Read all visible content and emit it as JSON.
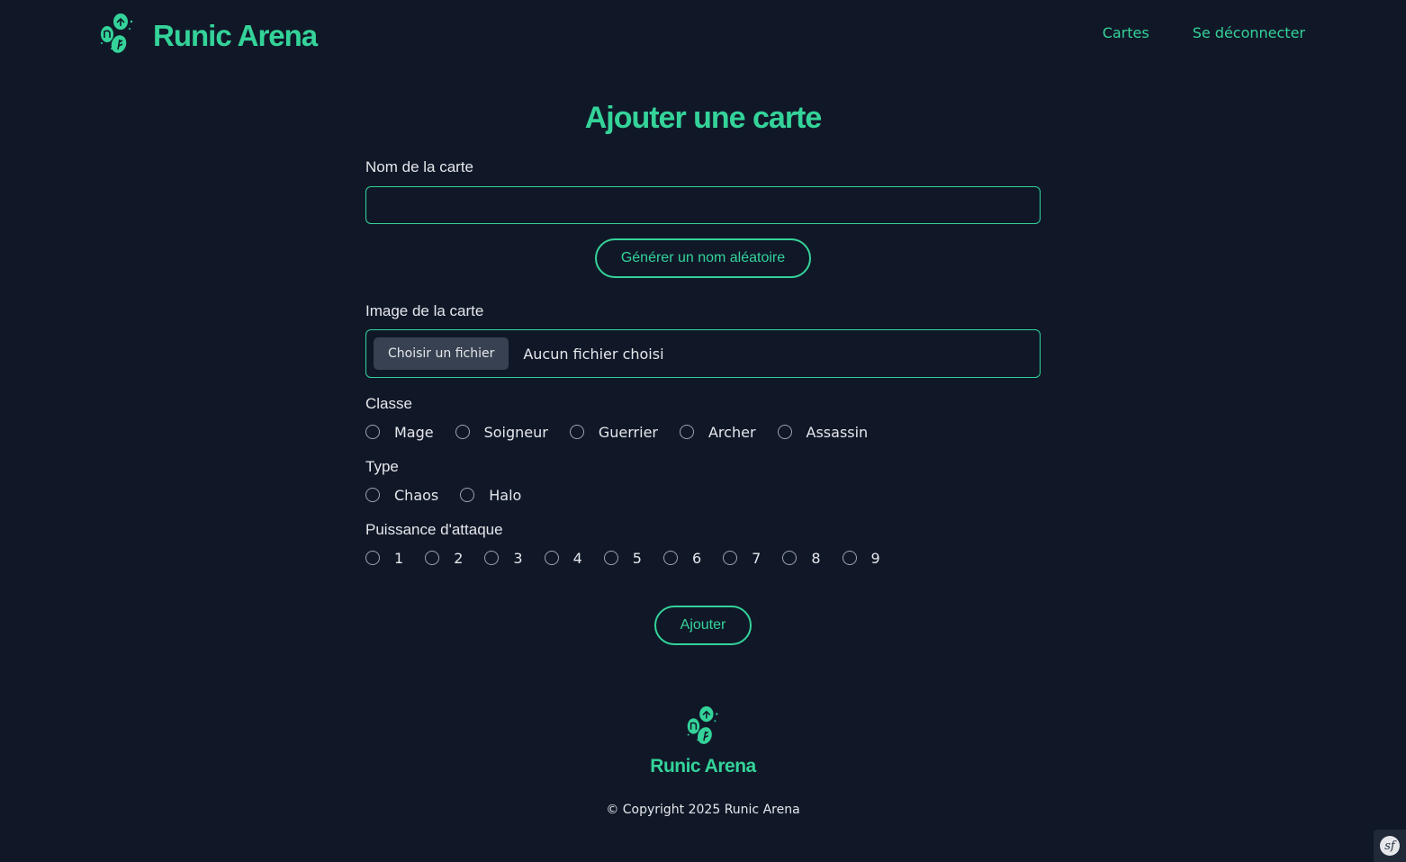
{
  "brand": {
    "name": "Runic Arena",
    "logo_icon": "runic-stones-icon"
  },
  "nav": {
    "items": [
      {
        "label": "Cartes"
      },
      {
        "label": "Se déconnecter"
      }
    ]
  },
  "form": {
    "title": "Ajouter une carte",
    "name": {
      "label": "Nom de la carte",
      "value": "",
      "placeholder": ""
    },
    "random_name_button": "Générer un nom aléatoire",
    "image": {
      "label": "Image de la carte",
      "button": "Choisir un fichier",
      "status": "Aucun fichier choisi"
    },
    "class": {
      "label": "Classe",
      "options": [
        "Mage",
        "Soigneur",
        "Guerrier",
        "Archer",
        "Assassin"
      ]
    },
    "type": {
      "label": "Type",
      "options": [
        "Chaos",
        "Halo"
      ]
    },
    "attack": {
      "label": "Puissance d'attaque",
      "options": [
        "1",
        "2",
        "3",
        "4",
        "5",
        "6",
        "7",
        "8",
        "9"
      ]
    },
    "submit": "Ajouter"
  },
  "footer": {
    "brand_name": "Runic Arena",
    "copyright": "© Copyright 2025 Runic Arena"
  },
  "colors": {
    "background": "#101828",
    "accent": "#34d399",
    "text": "#e5e7eb"
  }
}
